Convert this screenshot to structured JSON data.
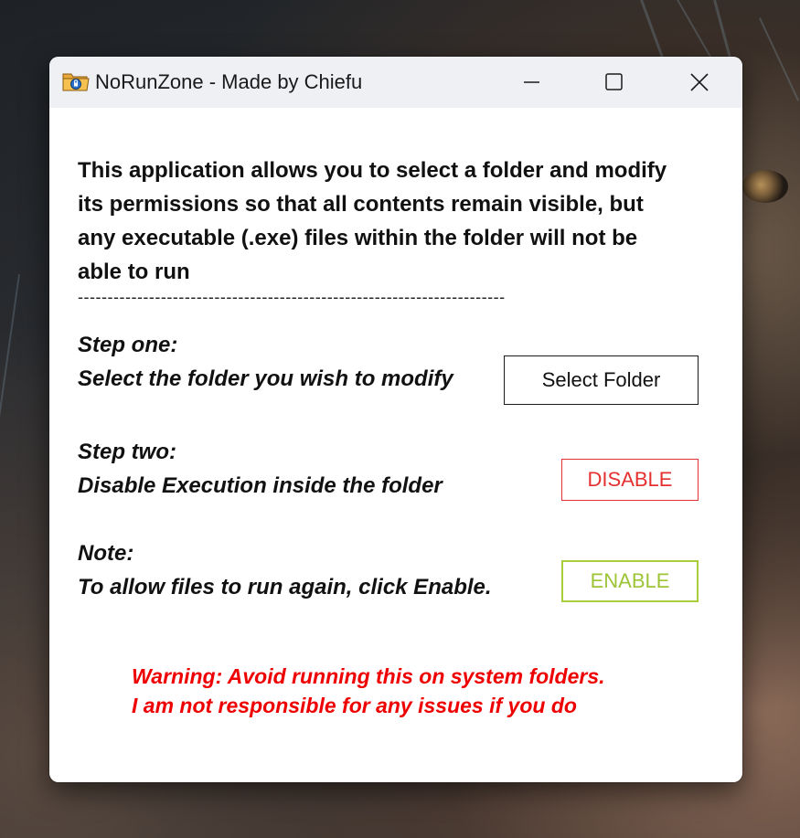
{
  "window": {
    "title": "NoRunZone - Made by Chiefu"
  },
  "titlebar_controls": {
    "minimize_icon": "minimize-icon",
    "maximize_icon": "maximize-icon",
    "close_icon": "close-icon"
  },
  "intro": {
    "line1": "This application allows you to select a folder and modify",
    "line2": "its permissions so that all contents remain visible, but",
    "line3": "any executable (.exe) files within the folder will not be",
    "line4": "able to run"
  },
  "divider": "------------------------------------------------------------------------",
  "steps": {
    "one": {
      "heading": "Step one:",
      "text": "Select the folder you wish to modify",
      "button": "Select Folder"
    },
    "two": {
      "heading": "Step two:",
      "text": "Disable Execution inside the folder",
      "button": "DISABLE"
    },
    "note": {
      "heading": "Note:",
      "text": "To allow files to run again, click Enable.",
      "button": "ENABLE"
    }
  },
  "warning": {
    "line1": "Warning: Avoid running this on system folders.",
    "line2": "I am not responsible for any issues if you do"
  },
  "colors": {
    "disable": "#e53030",
    "enable": "#9cc436",
    "warning": "#ee0000",
    "titlebar": "#eef0f4"
  }
}
